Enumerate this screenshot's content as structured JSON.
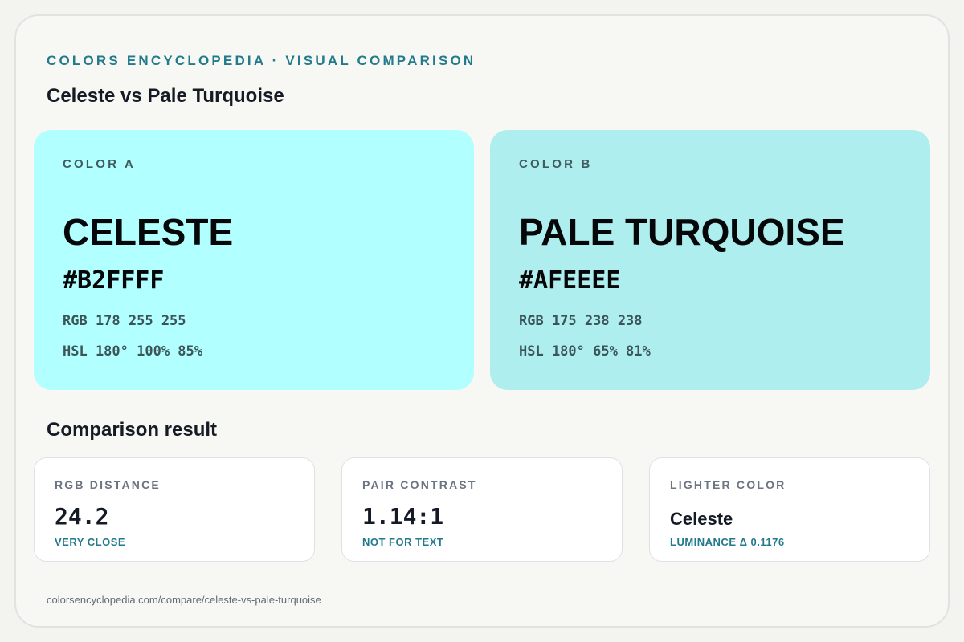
{
  "header": {
    "eyebrow": "COLORS ENCYCLOPEDIA · VISUAL COMPARISON",
    "title": "Celeste vs Pale Turquoise"
  },
  "colors": [
    {
      "tag": "COLOR A",
      "name": "CELESTE",
      "hex": "#B2FFFF",
      "rgb": "RGB 178 255 255",
      "hsl": "HSL 180° 100% 85%",
      "swatch_color": "#B2FFFF"
    },
    {
      "tag": "COLOR B",
      "name": "PALE TURQUOISE",
      "hex": "#AFEEEE",
      "rgb": "RGB 175 238 238",
      "hsl": "HSL 180° 65% 81%",
      "swatch_color": "#AFEEEE"
    }
  ],
  "comparison": {
    "title": "Comparison result",
    "stats": [
      {
        "label": "RGB DISTANCE",
        "value": "24.2",
        "note": "VERY CLOSE"
      },
      {
        "label": "PAIR CONTRAST",
        "value": "1.14:1",
        "note": "NOT FOR TEXT"
      },
      {
        "label": "LIGHTER COLOR",
        "value": "Celeste",
        "note": "LUMINANCE Δ 0.1176"
      }
    ]
  },
  "footer": {
    "url": "colorsencyclopedia.com/compare/celeste-vs-pale-turquoise"
  },
  "theme": {
    "accent": "#237A8C",
    "page_bg": "#F7F7F4",
    "card_bg": "#FFFFFF"
  }
}
